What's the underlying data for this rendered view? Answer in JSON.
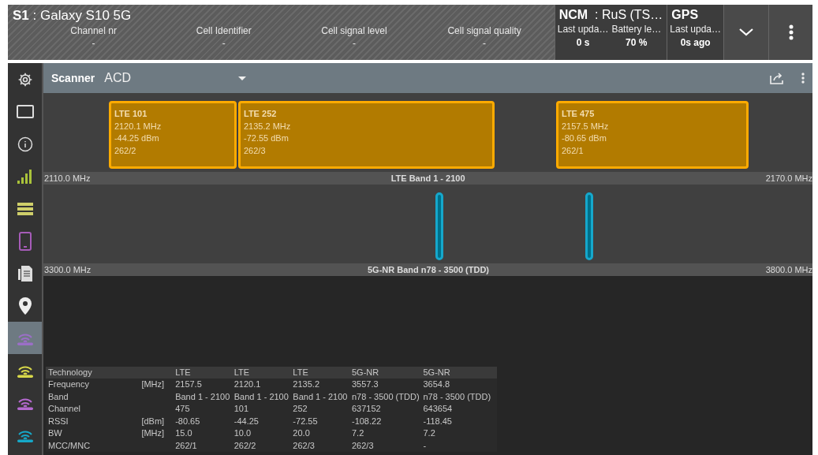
{
  "header": {
    "title": "**S1** : Galaxy S10 5G",
    "fields": [
      {
        "label": "Channel nr",
        "value": "-"
      },
      {
        "label": "Cell Identifier",
        "value": "-"
      },
      {
        "label": "Cell signal level",
        "value": "-"
      },
      {
        "label": "Cell signal quality",
        "value": "-"
      }
    ],
    "panels": [
      {
        "title": "**NCM**  : RuS (TS…",
        "items": [
          {
            "label": "Last upda…",
            "value": "0 s"
          },
          {
            "label": "Battery le…",
            "value": "70 %"
          }
        ]
      },
      {
        "title": "**GPS**",
        "items": [
          {
            "label": "Last upda…",
            "value": "0s ago"
          }
        ]
      }
    ]
  },
  "sidebar": {
    "items": [
      {
        "kind": "gear",
        "selected": false
      },
      {
        "kind": "monitor",
        "selected": false
      },
      {
        "kind": "info",
        "selected": false
      },
      {
        "kind": "signal",
        "selected": false
      },
      {
        "kind": "list",
        "selected": false
      },
      {
        "kind": "phone",
        "selected": false
      },
      {
        "kind": "document",
        "selected": false
      },
      {
        "kind": "pin",
        "selected": false
      },
      {
        "kind": "router",
        "color": "#9b6fc7",
        "selected": true
      },
      {
        "kind": "router",
        "color": "#d8d84a",
        "selected": false
      },
      {
        "kind": "router",
        "color": "#b56ad0",
        "selected": false
      },
      {
        "kind": "router",
        "color": "#16a8c8",
        "selected": false
      }
    ]
  },
  "toolbar": {
    "label": "Scanner",
    "value": "ACD"
  },
  "bands": [
    {
      "kind": "box",
      "start": "2110.0 MHz",
      "name": "LTE Band 1 - 2100",
      "end": "2170.0 MHz",
      "carriers": [
        {
          "title": "LTE 101",
          "frequency": "2120.1 MHz",
          "rssi": "-44.25 dBm",
          "mcc": "262/2"
        },
        {
          "title": "LTE 252",
          "frequency": "2135.2 MHz",
          "rssi": "-72.55 dBm",
          "mcc": "262/3"
        },
        {
          "title": "LTE 475",
          "frequency": "2157.5 MHz",
          "rssi": "-80.65 dBm",
          "mcc": "262/1"
        }
      ]
    },
    {
      "kind": "bar",
      "start": "3300.0 MHz",
      "name": "5G-NR Band n78 - 3500 (TDD)",
      "end": "3800.0 MHz"
    }
  ],
  "table": {
    "rows": [
      {
        "label": "Technology",
        "values": [
          "LTE",
          "LTE",
          "LTE",
          "5G-NR",
          "5G-NR"
        ]
      },
      {
        "label": "Frequency",
        "unit": "[MHz]",
        "values": [
          "2157.5",
          "2120.1",
          "2135.2",
          "3557.3",
          "3654.8"
        ]
      },
      {
        "label": "Band",
        "values": [
          "Band 1 - 2100",
          "Band 1 - 2100",
          "Band 1 - 2100",
          "n78 - 3500 (TDD)",
          "n78 - 3500 (TDD)"
        ]
      },
      {
        "label": "Channel",
        "values": [
          "475",
          "101",
          "252",
          "637152",
          "643654"
        ]
      },
      {
        "label": "RSSI",
        "unit": "[dBm]",
        "values": [
          "-80.65",
          "-44.25",
          "-72.55",
          "-108.22",
          "-118.45"
        ]
      },
      {
        "label": "BW",
        "unit": "[MHz]",
        "values": [
          "15.0",
          "10.0",
          "20.0",
          "7.2",
          "7.2"
        ]
      },
      {
        "label": "MCC/MNC",
        "values": [
          "262/1",
          "262/2",
          "262/3",
          "262/3",
          "-"
        ]
      }
    ]
  }
}
